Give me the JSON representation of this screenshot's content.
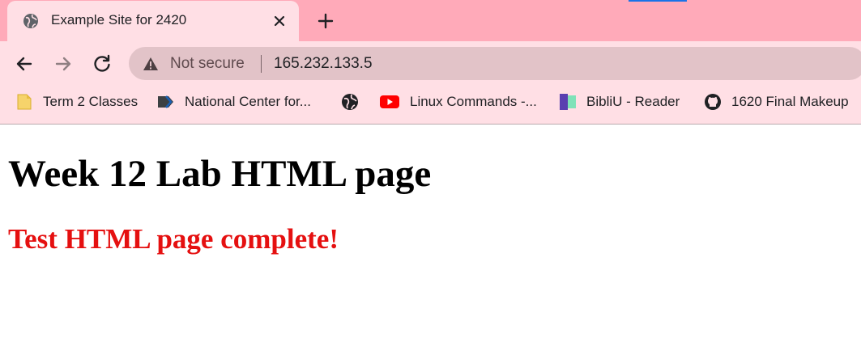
{
  "browser": {
    "tab": {
      "title": "Example Site for 2420",
      "favicon": "globe-icon"
    },
    "omnibox": {
      "security_label": "Not secure",
      "url": "165.232.133.5"
    },
    "bookmarks": [
      {
        "label": "Term 2 Classes",
        "icon": "folder-icon"
      },
      {
        "label": "National Center for...",
        "icon": "bookmark-arrow-icon"
      },
      {
        "label": "",
        "icon": "globe-icon"
      },
      {
        "label": "Linux Commands -...",
        "icon": "youtube-icon"
      },
      {
        "label": "BibliU - Reader",
        "icon": "bibliu-icon"
      },
      {
        "label": "1620 Final Makeup",
        "icon": "github-icon"
      }
    ]
  },
  "page": {
    "heading": "Week 12 Lab HTML page",
    "subheading": "Test HTML page complete!",
    "subheading_color": "#e51010"
  },
  "colors": {
    "tabstrip": "#ffaab9",
    "toolbar": "#ffdfe5",
    "omnibox": "#e2c3c8"
  }
}
